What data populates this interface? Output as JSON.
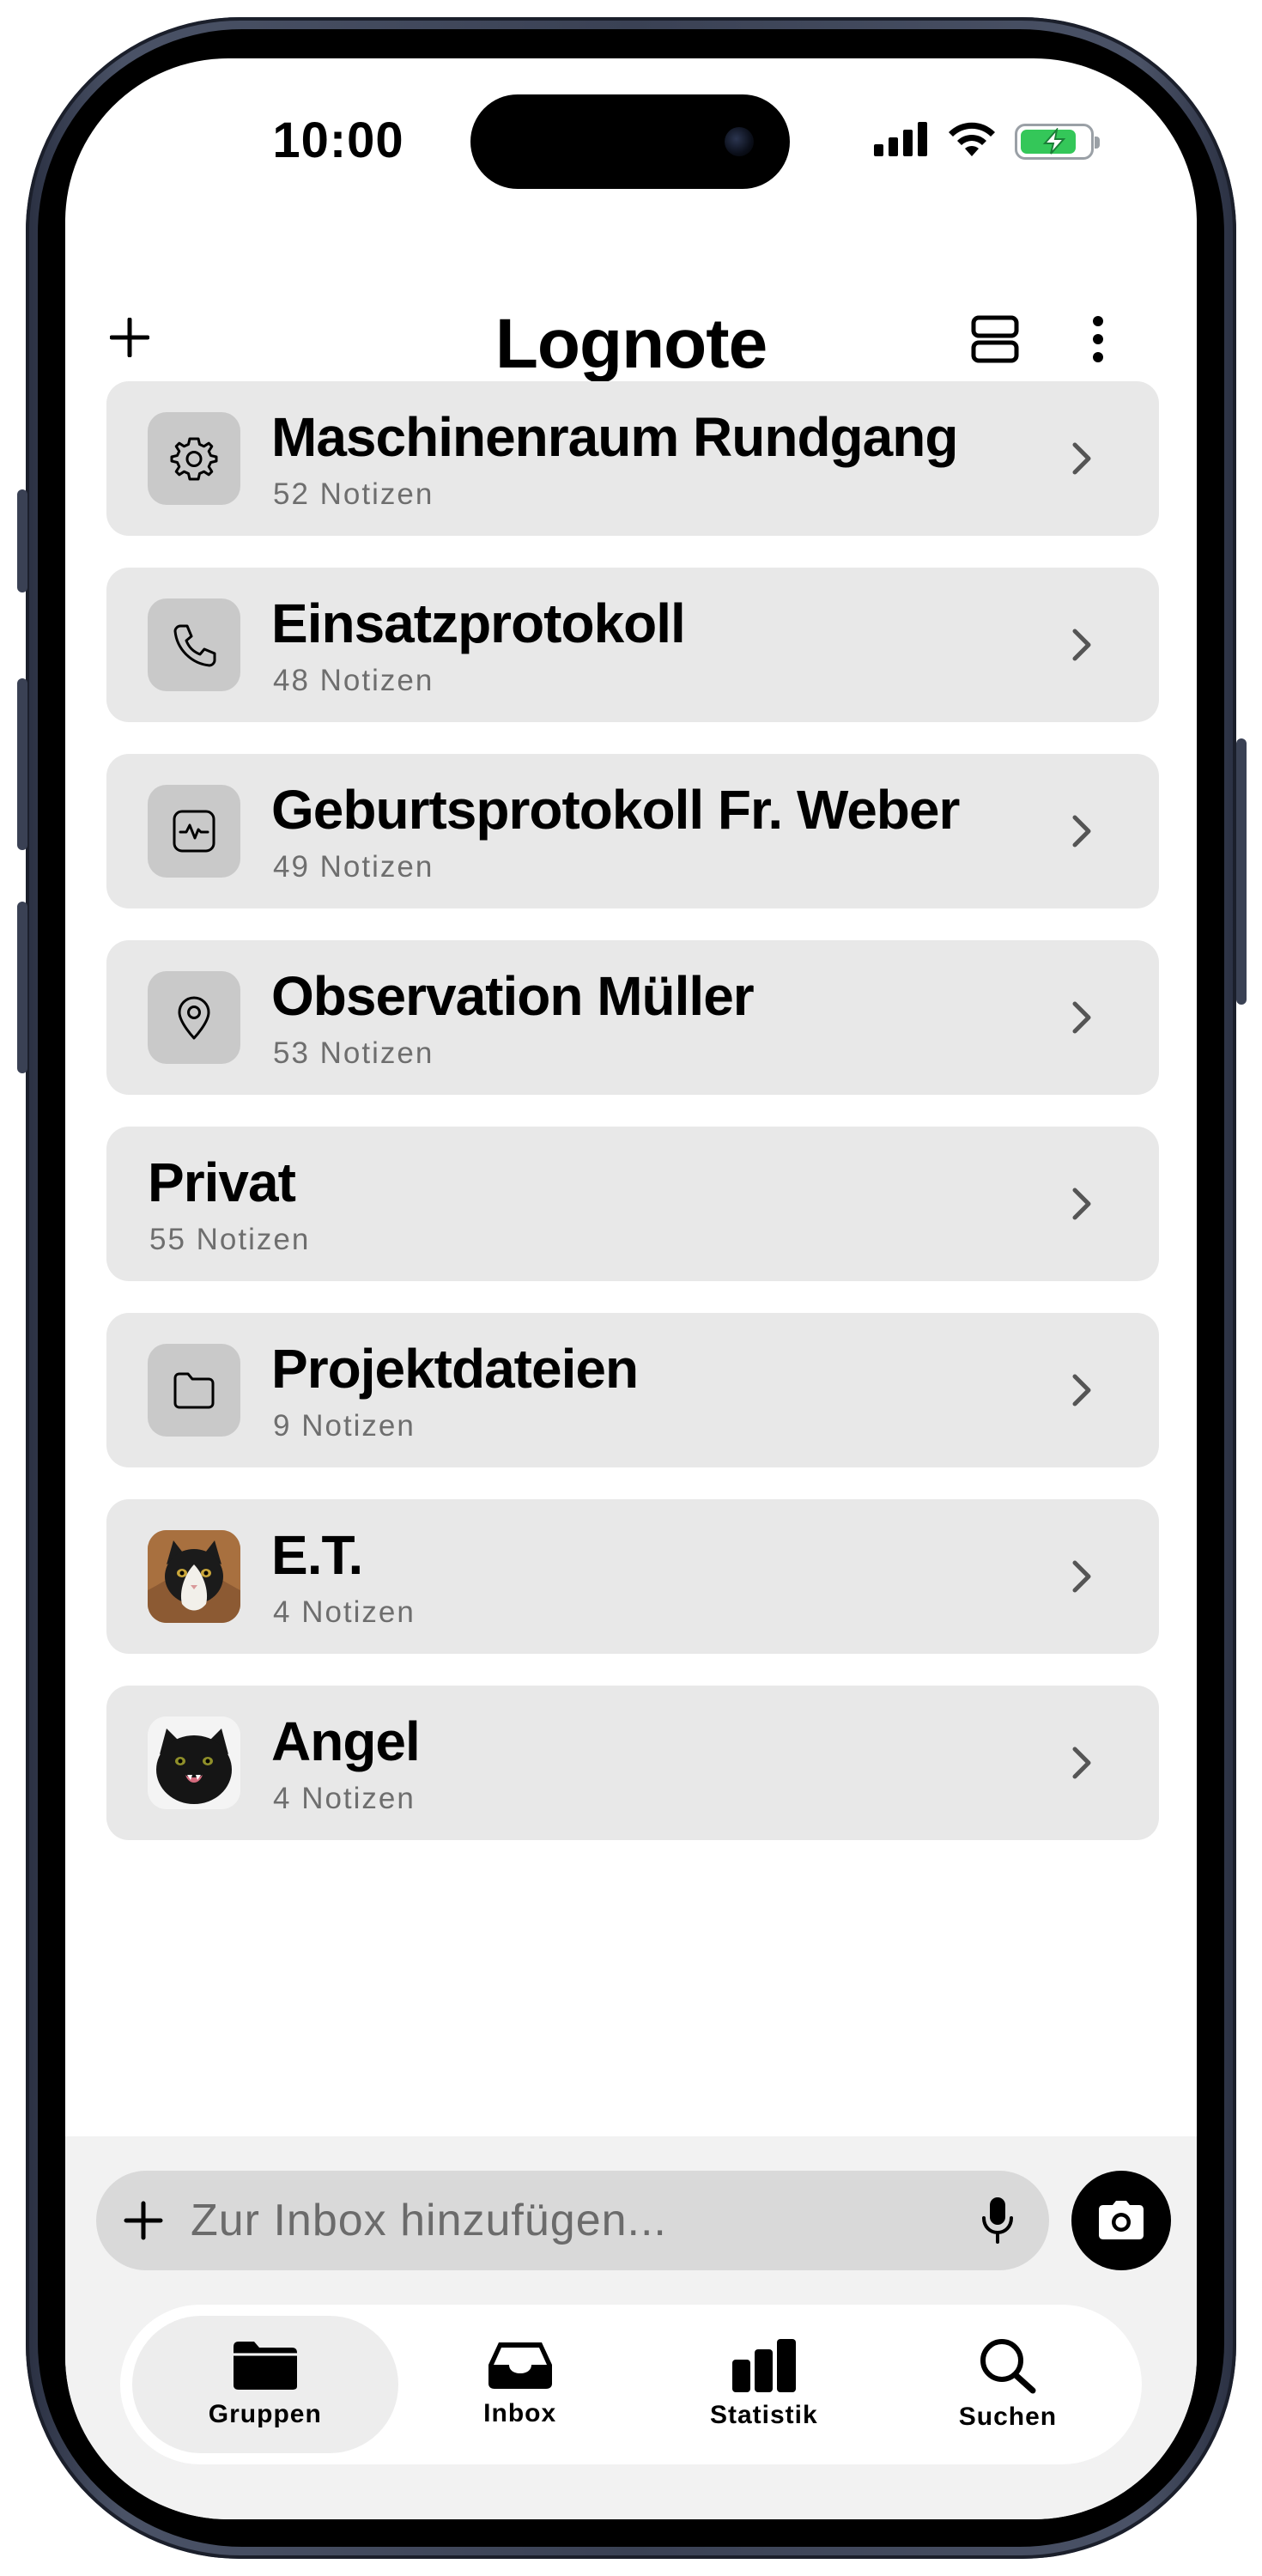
{
  "status_bar": {
    "time": "10:00"
  },
  "header": {
    "title": "Lognote"
  },
  "groups": [
    {
      "title": "Maschinenraum Rundgang",
      "count": "52 Notizen",
      "icon": "gear-icon"
    },
    {
      "title": "Einsatzprotokoll",
      "count": "48 Notizen",
      "icon": "phone-icon"
    },
    {
      "title": "Geburtsprotokoll Fr. Weber",
      "count": "49 Notizen",
      "icon": "heartbeat-monitor-icon"
    },
    {
      "title": "Observation Müller",
      "count": "53 Notizen",
      "icon": "location-pin-icon"
    },
    {
      "title": "Privat",
      "count": "55 Notizen",
      "icon": ""
    },
    {
      "title": "Projektdateien",
      "count": "9 Notizen",
      "icon": "folder-icon"
    },
    {
      "title": "E.T.",
      "count": "4 Notizen",
      "icon": "cat-photo-avatar"
    },
    {
      "title": "Angel",
      "count": "4 Notizen",
      "icon": "cat-photo-avatar"
    }
  ],
  "inbox": {
    "placeholder": "Zur Inbox hinzufügen..."
  },
  "tabs": [
    {
      "label": "Gruppen",
      "icon": "folder-icon",
      "active": true
    },
    {
      "label": "Inbox",
      "icon": "inbox-tray-icon",
      "active": false
    },
    {
      "label": "Statistik",
      "icon": "bar-chart-icon",
      "active": false
    },
    {
      "label": "Suchen",
      "icon": "magnifier-icon",
      "active": false
    }
  ],
  "colors": {
    "card": "#e8e8e8",
    "icon_tile": "#c9c9c9",
    "battery": "#34c759",
    "accent": "#000000"
  },
  "battery_level": 0.8
}
